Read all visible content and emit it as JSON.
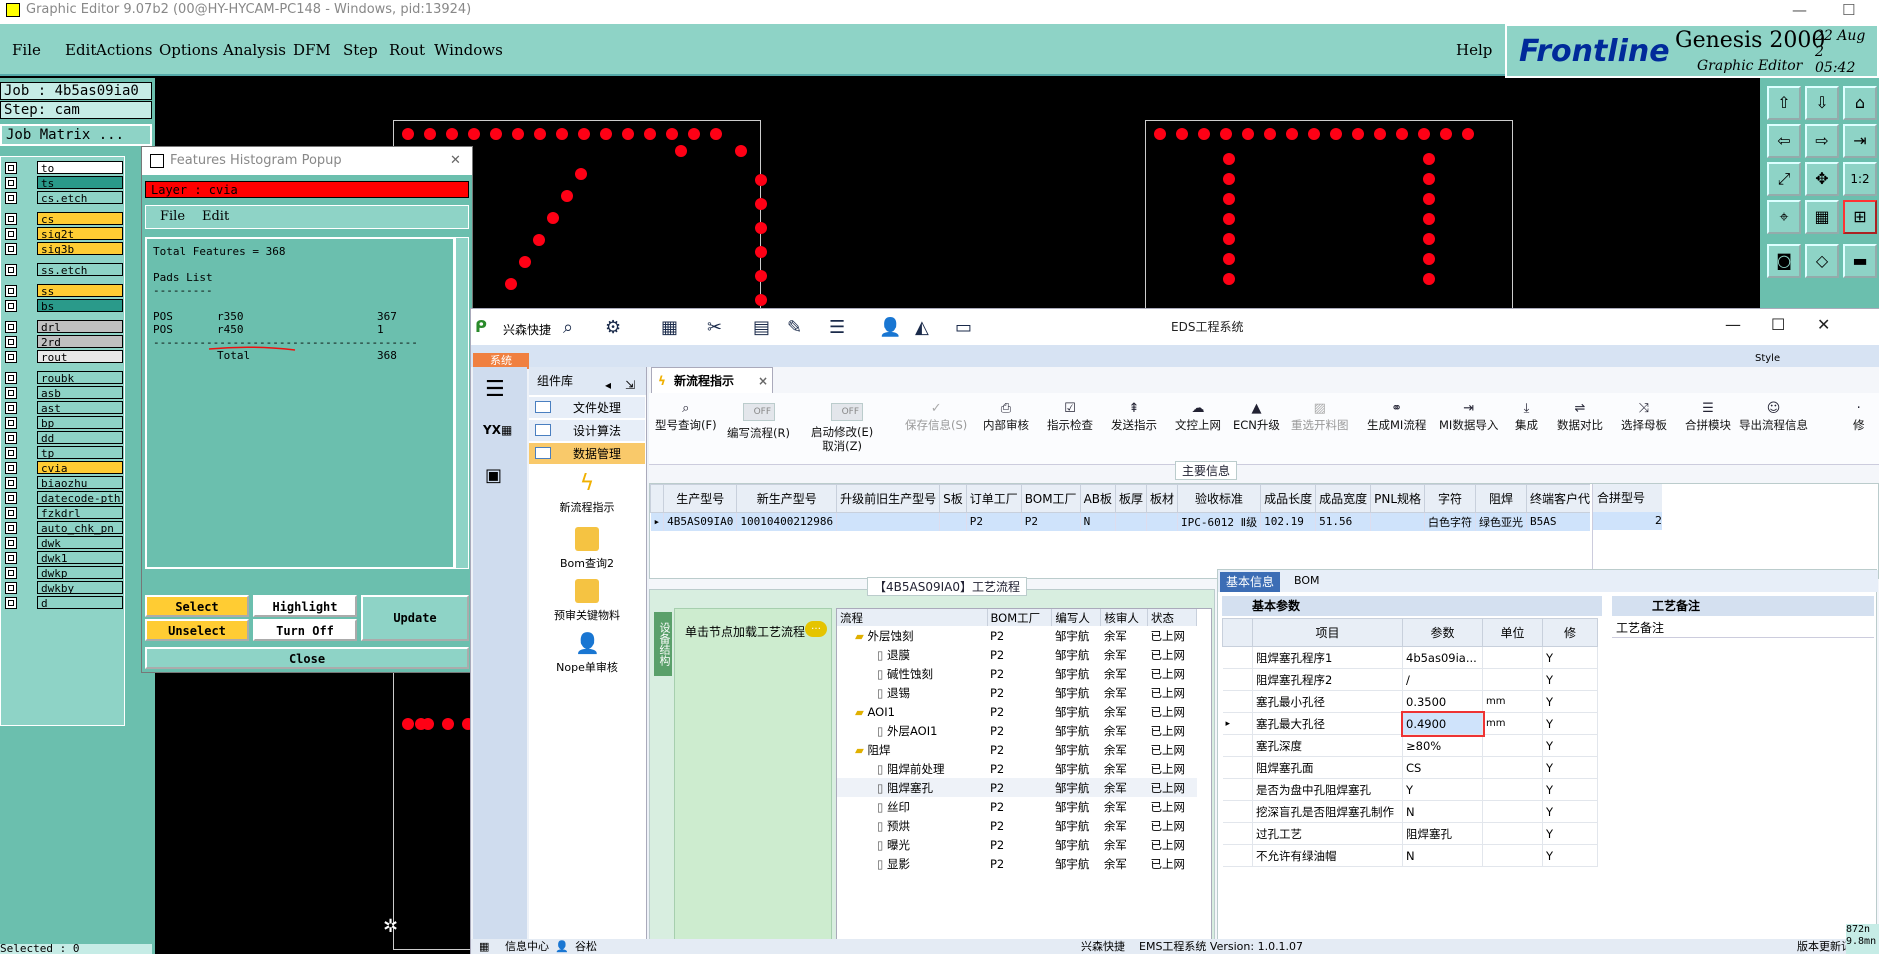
{
  "ge": {
    "title": "Graphic Editor 9.07b2 (00@HY-HYCAM-PC148 - Windows, pid:13924)",
    "menu": [
      "File",
      "Edit",
      "Actions",
      "Options",
      "Analysis",
      "DFM",
      "Step",
      "Rout",
      "Windows"
    ],
    "help": "Help",
    "brand": "Frontline",
    "product": "Genesis 2000",
    "subtitle": "Graphic Editor",
    "date": "22  Aug  2",
    "time": "05:42",
    "job": "Job : 4b5as09ia0",
    "step": "Step: cam",
    "job_matrix": "Job Matrix ...",
    "status": "Selected : 0",
    "readout": "872n",
    "readout2": "9.8mn"
  },
  "layers": [
    {
      "name": "to",
      "color": "#ffffff"
    },
    {
      "name": "ts",
      "color": "#2a9a8a"
    },
    {
      "name": "cs.etch",
      "color": "#8ed3c6"
    },
    {
      "name": "cs",
      "color": "#ffcc33"
    },
    {
      "name": "sig2t",
      "color": "#ffcc33"
    },
    {
      "name": "sig3b",
      "color": "#ffcc33"
    },
    {
      "name": "ss.etch",
      "color": "#8ed3c6"
    },
    {
      "name": "ss",
      "color": "#ffcc33"
    },
    {
      "name": "bs",
      "color": "#2a9a8a"
    },
    {
      "name": "drl",
      "color": "#c0c0c0"
    },
    {
      "name": "2rd",
      "color": "#c0c0c0"
    },
    {
      "name": "rout",
      "color": "#e8e8e8"
    },
    {
      "name": "roubk",
      "color": "#8ed3c6"
    },
    {
      "name": "asb",
      "color": "#8ed3c6"
    },
    {
      "name": "ast",
      "color": "#8ed3c6"
    },
    {
      "name": "bp",
      "color": "#8ed3c6"
    },
    {
      "name": "dd",
      "color": "#8ed3c6"
    },
    {
      "name": "tp",
      "color": "#8ed3c6"
    },
    {
      "name": "cvia",
      "color": "#ffcc33"
    },
    {
      "name": "biaozhu",
      "color": "#8ed3c6"
    },
    {
      "name": "datecode-pth",
      "color": "#8ed3c6"
    },
    {
      "name": "fzkdrl",
      "color": "#8ed3c6"
    },
    {
      "name": "auto_chk_pn",
      "color": "#8ed3c6"
    },
    {
      "name": "dwk",
      "color": "#8ed3c6"
    },
    {
      "name": "dwk1",
      "color": "#8ed3c6"
    },
    {
      "name": "dwkp",
      "color": "#8ed3c6"
    },
    {
      "name": "dwkby",
      "color": "#8ed3c6"
    },
    {
      "name": "d",
      "color": "#8ed3c6"
    }
  ],
  "hist": {
    "title": "Features Histogram Popup",
    "layer": "Layer : cvia",
    "menu": [
      "File",
      "Edit"
    ],
    "total": "Total Features = 368",
    "pads": "Pads List",
    "sep1": "---------",
    "r1": {
      "t": "POS",
      "s": "r350",
      "n": "367"
    },
    "r2": {
      "t": "POS",
      "s": "r450",
      "n": "1"
    },
    "sep2": "----------------------------------------",
    "tot": {
      "l": "Total",
      "n": "368"
    },
    "buttons": {
      "select": "Select",
      "highlight": "Highlight",
      "update": "Update",
      "unselect": "Unselect",
      "turnoff": "Turn Off",
      "close": "Close"
    }
  },
  "eds": {
    "title": "EDS工程系统",
    "qa": "兴森快捷",
    "systab": "系统",
    "style": "Style",
    "component": "组件库",
    "nav": [
      "文件处理",
      "设计算法",
      "数据管理"
    ],
    "big": [
      "新流程指示",
      "Bom查询2",
      "预审关键物料",
      "Nope单审核"
    ],
    "doctab": "新流程指示",
    "ribbon": {
      "model": "型号查询(F)",
      "edit_flow": "编写流程(R)",
      "start_mod": "启动修改(E)",
      "cancel": "取消(Z)",
      "save": "保存信息(S)",
      "buttons": [
        "内部审核",
        "指示检查",
        "发送指示",
        "文控上网",
        "ECN升级",
        "重选开料图",
        "生成MI流程",
        "MI数据导入",
        "集成",
        "数据对比",
        "选择母板",
        "合拼模块",
        "导出流程信息",
        "修"
      ],
      "off": "OFF"
    },
    "main_info": "主要信息",
    "grid": {
      "headers": [
        "生产型号",
        "新生产型号",
        "升级前旧生产型号",
        "S板",
        "订单工厂",
        "BOM工厂",
        "AB板",
        "板厚",
        "板材",
        "验收标准",
        "成品长度",
        "成品宽度",
        "PNL规格",
        "字符",
        "阻焊",
        "终端客户代码"
      ],
      "row": [
        "4B5AS09IA0",
        "10010400212986",
        "",
        "",
        "P2",
        "P2",
        "N",
        "",
        "",
        "IPC-6012 Ⅱ级",
        "102.19",
        "51.56",
        "",
        "白色字符",
        "绿色亚光",
        "B5AS"
      ],
      "extra_header": "合拼型号",
      "extra_val": "2"
    },
    "process_title": "【4B5AS09IA0】工艺流程",
    "side_label": "设备结构",
    "load_hint": "单击节点加载工艺流程",
    "tree_headers": [
      "流程",
      "BOM工厂",
      "编写人",
      "核审人",
      "状态"
    ],
    "tree": [
      {
        "level": 1,
        "name": "外层蚀刻",
        "bom": "P2",
        "w": "邹宇航",
        "a": "余军",
        "s": "已上网"
      },
      {
        "level": 2,
        "name": "退膜",
        "bom": "P2",
        "w": "邹宇航",
        "a": "余军",
        "s": "已上网"
      },
      {
        "level": 2,
        "name": "碱性蚀刻",
        "bom": "P2",
        "w": "邹宇航",
        "a": "余军",
        "s": "已上网"
      },
      {
        "level": 2,
        "name": "退锡",
        "bom": "P2",
        "w": "邹宇航",
        "a": "余军",
        "s": "已上网"
      },
      {
        "level": 1,
        "name": "AOI1",
        "bom": "P2",
        "w": "邹宇航",
        "a": "余军",
        "s": "已上网"
      },
      {
        "level": 2,
        "name": "外层AOI1",
        "bom": "P2",
        "w": "邹宇航",
        "a": "余军",
        "s": "已上网"
      },
      {
        "level": 1,
        "name": "阻焊",
        "bom": "P2",
        "w": "邹宇航",
        "a": "余军",
        "s": "已上网"
      },
      {
        "level": 2,
        "name": "阻焊前处理",
        "bom": "P2",
        "w": "邹宇航",
        "a": "余军",
        "s": "已上网"
      },
      {
        "level": 2,
        "name": "阻焊塞孔",
        "bom": "P2",
        "w": "邹宇航",
        "a": "余军",
        "s": "已上网"
      },
      {
        "level": 2,
        "name": "丝印",
        "bom": "P2",
        "w": "邹宇航",
        "a": "余军",
        "s": "已上网"
      },
      {
        "level": 2,
        "name": "预烘",
        "bom": "P2",
        "w": "邹宇航",
        "a": "余军",
        "s": "已上网"
      },
      {
        "level": 2,
        "name": "曝光",
        "bom": "P2",
        "w": "邹宇航",
        "a": "余军",
        "s": "已上网"
      },
      {
        "level": 2,
        "name": "显影",
        "bom": "P2",
        "w": "邹宇航",
        "a": "余军",
        "s": "已上网"
      }
    ],
    "tabs": [
      "基本信息",
      "BOM"
    ],
    "basic_params": "基本参数",
    "proc_note": "工艺备注",
    "param_headers": [
      "项目",
      "参数",
      "单位",
      "修"
    ],
    "params": [
      {
        "k": "阻焊塞孔程序1",
        "v": "4b5as09ia...",
        "u": "",
        "f": "Y"
      },
      {
        "k": "阻焊塞孔程序2",
        "v": "/",
        "u": "",
        "f": "Y"
      },
      {
        "k": "塞孔最小孔径",
        "v": "0.3500",
        "u": "mm",
        "f": "Y"
      },
      {
        "k": "塞孔最大孔径",
        "v": "0.4900",
        "u": "mm",
        "f": "Y"
      },
      {
        "k": "塞孔深度",
        "v": "≥80%",
        "u": "",
        "f": "Y"
      },
      {
        "k": "阻焊塞孔面",
        "v": "CS",
        "u": "",
        "f": "Y"
      },
      {
        "k": "是否为盘中孔阻焊塞孔",
        "v": "Y",
        "u": "",
        "f": "Y"
      },
      {
        "k": "挖深盲孔是否阻焊塞孔制作",
        "v": "N",
        "u": "",
        "f": "Y"
      },
      {
        "k": "过孔工艺",
        "v": "阻焊塞孔",
        "u": "",
        "f": "Y"
      },
      {
        "k": "不允许有绿油帽",
        "v": "N",
        "u": "",
        "f": "Y"
      }
    ],
    "status": {
      "info": "信息中心",
      "user": "谷松",
      "company": "兴森快捷",
      "version": "EMS工程系统 Version: 1.0.1.07",
      "last": "版本更新记录"
    }
  }
}
